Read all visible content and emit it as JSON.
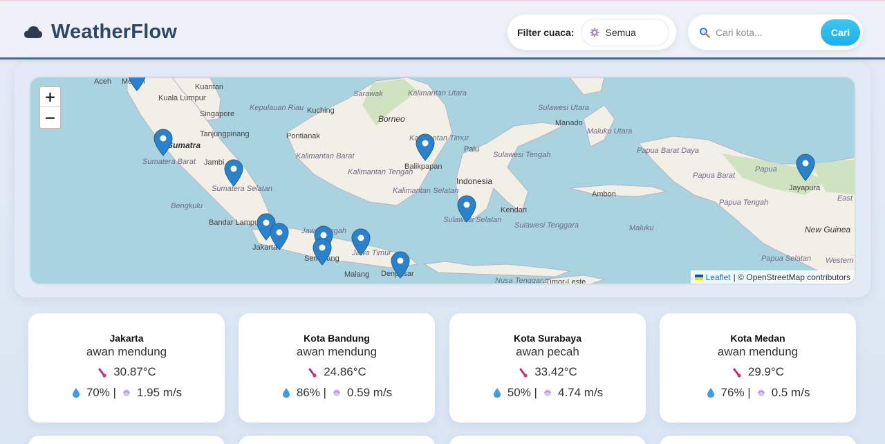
{
  "app": {
    "title": "WeatherFlow",
    "logo_icon": "cloud-icon"
  },
  "filter": {
    "label": "Filter cuaca:",
    "selected": "Semua",
    "icon": "gear-icon"
  },
  "search": {
    "placeholder": "Cari kota...",
    "button_label": "Cari",
    "icon": "search-icon"
  },
  "map": {
    "zoom_in": "+",
    "zoom_out": "−",
    "attribution": {
      "link": "Leaflet",
      "text": "| © OpenStreetMap contributors"
    },
    "labels": [
      "Aceh",
      "Medan",
      "Kuantan",
      "Kuala Lumpur",
      "Singapore",
      "Tanjungpinang",
      "Sumatra",
      "Sumatera Barat",
      "Jambi",
      "Sumatera Selatan",
      "Bengkulu",
      "Bandar Lampung",
      "Jakarta",
      "Jawa Tengah",
      "Semarang",
      "Jawa Timur",
      "Malang",
      "Denpasar",
      "Kepulauan Riau",
      "Kuching",
      "Sarawak",
      "Borneo",
      "Kalimantan Utara",
      "Pontianak",
      "Kalimantan Barat",
      "Kalimantan Tengah",
      "Kalimantan Selatan",
      "Kalimantan Timur",
      "Balikpapan",
      "Palu",
      "Sulawesi Tengah",
      "Sulawesi Utara",
      "Manado",
      "Maluku Utara",
      "Indonesia",
      "Sulawesi Selatan",
      "Kendari",
      "Sulawesi Tenggara",
      "Ambon",
      "Maluku",
      "Papua Barat Daya",
      "Papua Barat",
      "Papua",
      "Papua Tengah",
      "Jayapura",
      "New Guinea",
      "Papua Selatan",
      "East S",
      "Western",
      "Nusa Tenggara",
      "Timor-Leste"
    ],
    "marker_count": 14
  },
  "cards": [
    {
      "city": "Jakarta",
      "desc": "awan mendung",
      "temp": "30.87°C",
      "humidity": "70% |",
      "wind": "1.95 m/s"
    },
    {
      "city": "Kota Bandung",
      "desc": "awan mendung",
      "temp": "24.86°C",
      "humidity": "86% |",
      "wind": "0.59 m/s"
    },
    {
      "city": "Kota Surabaya",
      "desc": "awan pecah",
      "temp": "33.42°C",
      "humidity": "50% |",
      "wind": "4.74 m/s"
    },
    {
      "city": "Kota Medan",
      "desc": "awan mendung",
      "temp": "29.9°C",
      "humidity": "76% |",
      "wind": "0.5 m/s"
    }
  ],
  "colors": {
    "accent": "#1eaeea",
    "brand": "#2c4763",
    "marker": "#2b82cb",
    "water": "#a9d3df",
    "land": "#f2efe6"
  }
}
